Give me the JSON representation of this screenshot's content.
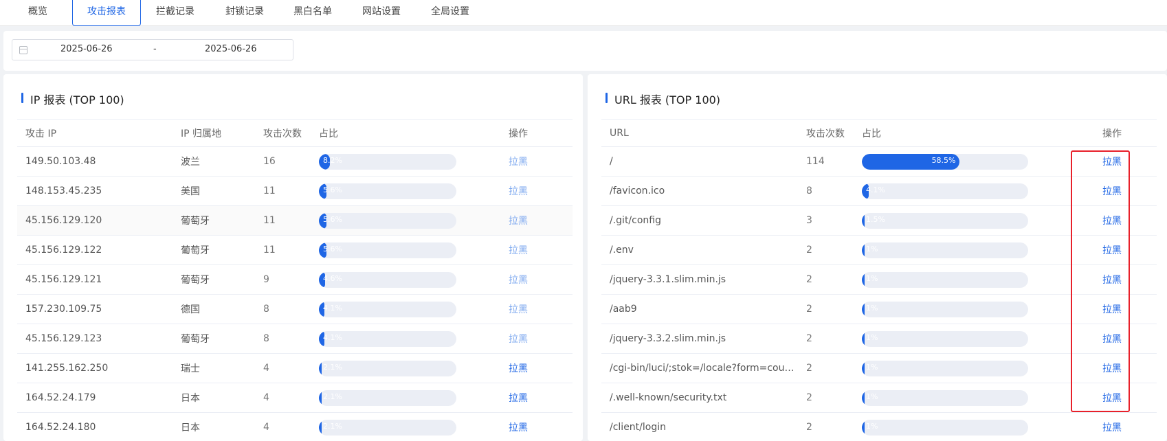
{
  "tabs": [
    {
      "label": "概览",
      "active": false
    },
    {
      "label": "攻击报表",
      "active": true
    },
    {
      "label": "拦截记录",
      "active": false
    },
    {
      "label": "封锁记录",
      "active": false
    },
    {
      "label": "黑白名单",
      "active": false
    },
    {
      "label": "网站设置",
      "active": false
    },
    {
      "label": "全局设置",
      "active": false
    }
  ],
  "filter": {
    "start_date": "2025-06-26",
    "separator": "-",
    "end_date": "2025-06-26"
  },
  "ip_report": {
    "title": "IP 报表 (TOP 100)",
    "headers": [
      "攻击 IP",
      "IP 归属地",
      "攻击次数",
      "占比",
      "操作"
    ],
    "rows": [
      {
        "ip": "149.50.103.48",
        "location": "波兰",
        "count": "16",
        "pct_label": "8.2%",
        "pct": 8.2,
        "action": "拉黑"
      },
      {
        "ip": "148.153.45.235",
        "location": "美国",
        "count": "11",
        "pct_label": "5.6%",
        "pct": 5.6,
        "action": "拉黑"
      },
      {
        "ip": "45.156.129.120",
        "location": "葡萄牙",
        "count": "11",
        "pct_label": "5.6%",
        "pct": 5.6,
        "action": "拉黑"
      },
      {
        "ip": "45.156.129.122",
        "location": "葡萄牙",
        "count": "11",
        "pct_label": "5.6%",
        "pct": 5.6,
        "action": "拉黑"
      },
      {
        "ip": "45.156.129.121",
        "location": "葡萄牙",
        "count": "9",
        "pct_label": "4.6%",
        "pct": 4.6,
        "action": "拉黑"
      },
      {
        "ip": "157.230.109.75",
        "location": "德国",
        "count": "8",
        "pct_label": "4.1%",
        "pct": 4.1,
        "action": "拉黑"
      },
      {
        "ip": "45.156.129.123",
        "location": "葡萄牙",
        "count": "8",
        "pct_label": "4.1%",
        "pct": 4.1,
        "action": "拉黑"
      },
      {
        "ip": "141.255.162.250",
        "location": "瑞士",
        "count": "4",
        "pct_label": "2.1%",
        "pct": 2.1,
        "action": "拉黑"
      },
      {
        "ip": "164.52.24.179",
        "location": "日本",
        "count": "4",
        "pct_label": "2.1%",
        "pct": 2.1,
        "action": "拉黑"
      },
      {
        "ip": "164.52.24.180",
        "location": "日本",
        "count": "4",
        "pct_label": "2.1%",
        "pct": 2.1,
        "action": "拉黑"
      }
    ]
  },
  "url_report": {
    "title": "URL 报表 (TOP 100)",
    "headers": [
      "URL",
      "攻击次数",
      "占比",
      "操作"
    ],
    "rows": [
      {
        "url": "/",
        "count": "114",
        "pct_label": "58.5%",
        "pct": 58.5,
        "action": "拉黑"
      },
      {
        "url": "/favicon.ico",
        "count": "8",
        "pct_label": "4.1%",
        "pct": 4.1,
        "action": "拉黑"
      },
      {
        "url": "/.git/config",
        "count": "3",
        "pct_label": "1.5%",
        "pct": 1.5,
        "action": "拉黑"
      },
      {
        "url": "/.env",
        "count": "2",
        "pct_label": "1%",
        "pct": 1,
        "action": "拉黑"
      },
      {
        "url": "/jquery-3.3.1.slim.min.js",
        "count": "2",
        "pct_label": "1%",
        "pct": 1,
        "action": "拉黑"
      },
      {
        "url": "/aab9",
        "count": "2",
        "pct_label": "1%",
        "pct": 1,
        "action": "拉黑"
      },
      {
        "url": "/jquery-3.3.2.slim.min.js",
        "count": "2",
        "pct_label": "1%",
        "pct": 1,
        "action": "拉黑"
      },
      {
        "url": "/cgi-bin/luci/;stok=/locale?form=country...",
        "count": "2",
        "pct_label": "1%",
        "pct": 1,
        "action": "拉黑"
      },
      {
        "url": "/.well-known/security.txt",
        "count": "2",
        "pct_label": "1%",
        "pct": 1,
        "action": "拉黑"
      },
      {
        "url": "/client/login",
        "count": "2",
        "pct_label": "1%",
        "pct": 1,
        "action": "拉黑"
      }
    ]
  },
  "colors": {
    "accent": "#1f66e5",
    "highlight_box": "#e8202a"
  }
}
